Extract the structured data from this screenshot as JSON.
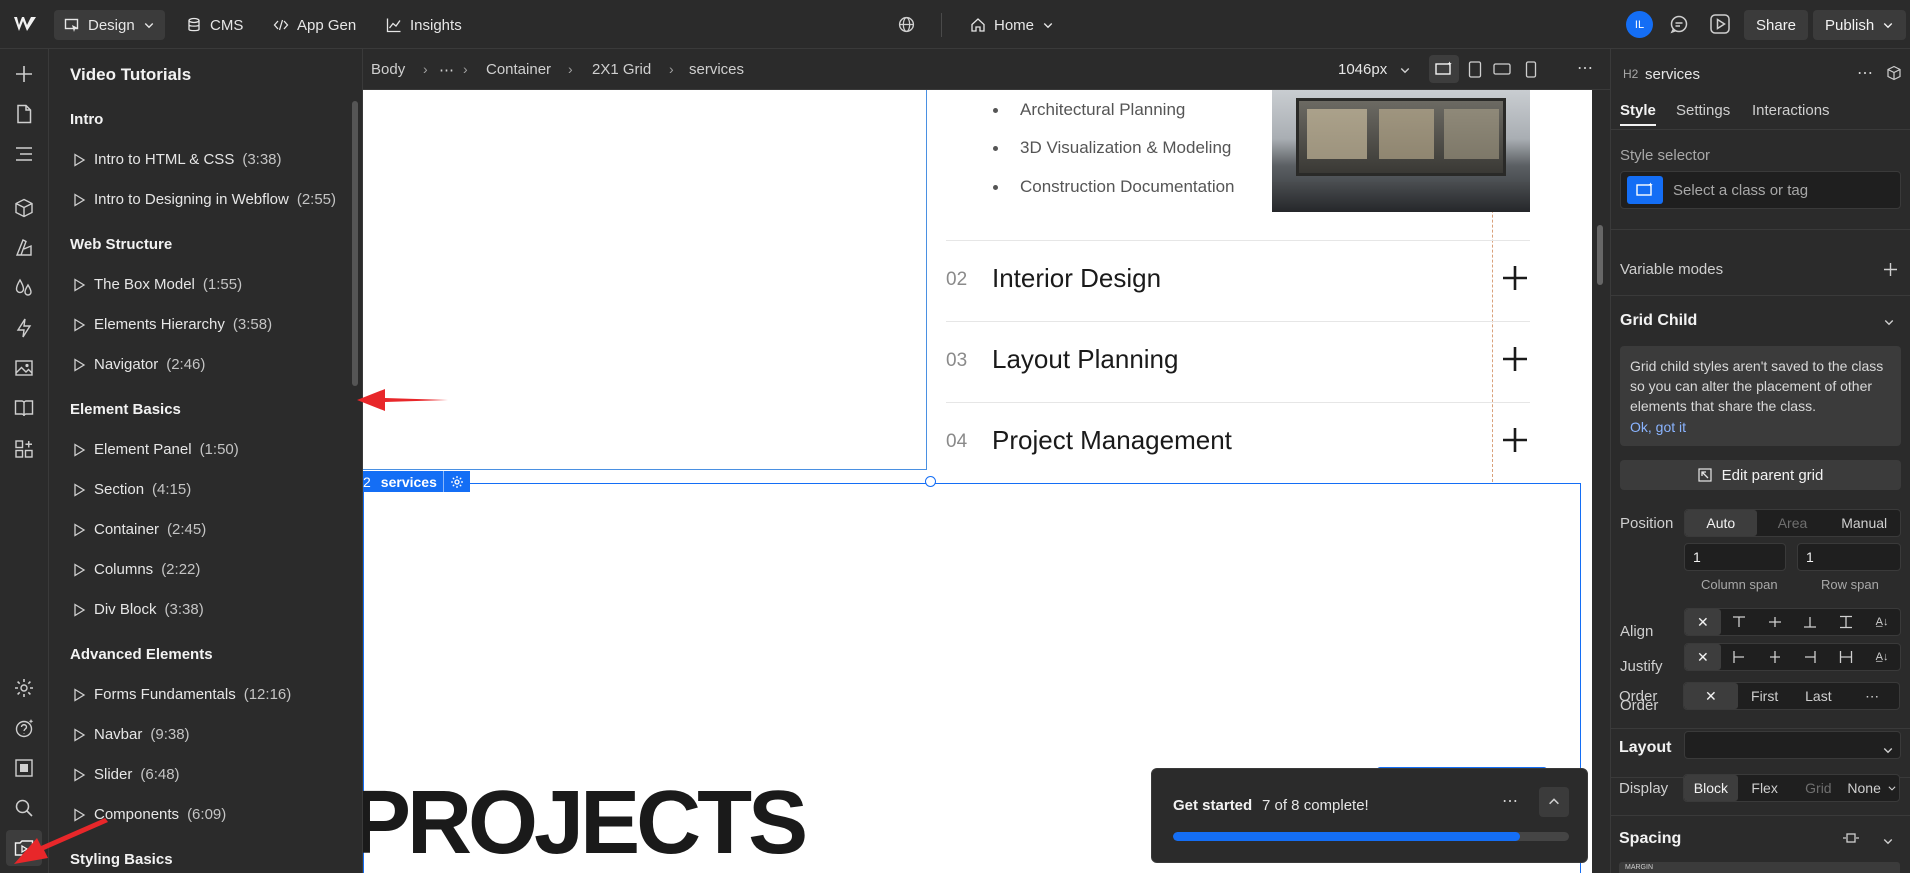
{
  "topbar": {
    "design_label": "Design",
    "cms_label": "CMS",
    "appgen_label": "App Gen",
    "insights_label": "Insights",
    "page_label": "Home",
    "avatar_initials": "IL",
    "share_label": "Share",
    "publish_label": "Publish"
  },
  "tutorials": {
    "title": "Video Tutorials",
    "sections": [
      {
        "heading": "Intro",
        "items": [
          {
            "label": "Intro to HTML & CSS",
            "duration": "(3:38)"
          },
          {
            "label": "Intro to Designing in Webflow",
            "duration": "(2:55)"
          }
        ]
      },
      {
        "heading": "Web Structure",
        "items": [
          {
            "label": "The Box Model",
            "duration": "(1:55)"
          },
          {
            "label": "Elements Hierarchy",
            "duration": "(3:58)"
          },
          {
            "label": "Navigator",
            "duration": "(2:46)"
          }
        ]
      },
      {
        "heading": "Element Basics",
        "items": [
          {
            "label": "Element Panel",
            "duration": "(1:50)"
          },
          {
            "label": "Section",
            "duration": "(4:15)"
          },
          {
            "label": "Container",
            "duration": "(2:45)"
          },
          {
            "label": "Columns",
            "duration": "(2:22)"
          },
          {
            "label": "Div Block",
            "duration": "(3:38)"
          }
        ]
      },
      {
        "heading": "Advanced Elements",
        "items": [
          {
            "label": "Forms Fundamentals",
            "duration": "(12:16)"
          },
          {
            "label": "Navbar",
            "duration": "(9:38)"
          },
          {
            "label": "Slider",
            "duration": "(6:48)"
          },
          {
            "label": "Components",
            "duration": "(6:09)"
          }
        ]
      },
      {
        "heading": "Styling Basics",
        "items": []
      }
    ]
  },
  "breadcrumb": {
    "items": [
      "Body",
      "⋯",
      "Container",
      "2X1 Grid",
      "services"
    ],
    "width_label": "1046px"
  },
  "canvas": {
    "bullets": [
      "Architectural Planning",
      "3D Visualization & Modeling",
      "Construction Documentation"
    ],
    "services": [
      {
        "num": "02",
        "title": "Interior Design"
      },
      {
        "num": "03",
        "title": "Layout Planning"
      },
      {
        "num": "04",
        "title": "Project Management"
      }
    ],
    "selected_tag": "services",
    "selected_tag_prefix": "2",
    "big_heading": "PROJECTS"
  },
  "toast": {
    "title": "Get started",
    "status": "7 of 8 complete!",
    "progress": 0.875
  },
  "rightpanel": {
    "element_tag": "H2",
    "element_name": "services",
    "tabs": [
      "Style",
      "Settings",
      "Interactions"
    ],
    "style_selector_label": "Style selector",
    "style_selector_placeholder": "Select a class or tag",
    "variable_modes_label": "Variable modes",
    "grid_child": {
      "title": "Grid Child",
      "note": "Grid child styles aren't saved to the class so you can alter the placement of other elements that share the class.",
      "ok_link": "Ok, got it",
      "edit_parent_label": "Edit parent grid",
      "position_label": "Position",
      "position_options": [
        "Auto",
        "Area",
        "Manual"
      ],
      "column_span_value": "1",
      "row_span_value": "1",
      "column_span_label": "Column span",
      "row_span_label": "Row span",
      "align_label": "Align",
      "justify_label": "Justify",
      "order_label": "Order",
      "order_options": [
        "First",
        "Last"
      ]
    },
    "layout": {
      "title": "Layout",
      "display_label": "Display",
      "display_options": [
        "Block",
        "Flex",
        "Grid",
        "None"
      ]
    },
    "spacing": {
      "title": "Spacing",
      "margin_label": "MARGIN"
    }
  },
  "colors": {
    "accent": "#146ef5",
    "arrow": "#e8272a"
  }
}
